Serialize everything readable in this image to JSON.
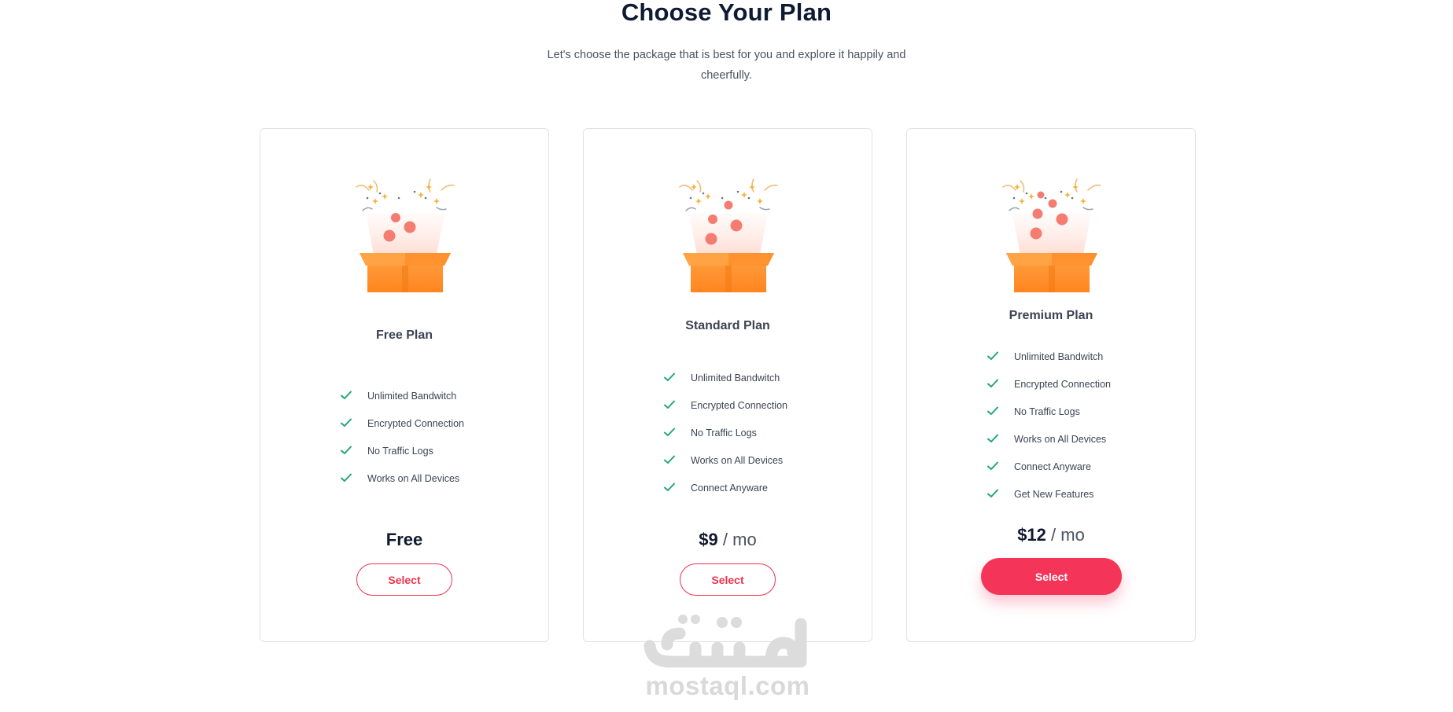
{
  "header": {
    "title": "Choose Your Plan",
    "subtitle_line1": "Let's choose the package that is best for you and explore it happily and",
    "subtitle_line2": "cheerfully."
  },
  "plans": [
    {
      "name": "Free Plan",
      "features": [
        "Unlimited Bandwitch",
        "Encrypted Connection",
        "No Traffic Logs",
        "Works on All Devices"
      ],
      "price": "Free",
      "period": "",
      "button_label": "Select"
    },
    {
      "name": "Standard Plan",
      "features": [
        "Unlimited Bandwitch",
        "Encrypted Connection",
        "No Traffic Logs",
        "Works on All Devices",
        "Connect Anyware"
      ],
      "price": "$9",
      "period": " / mo",
      "button_label": "Select"
    },
    {
      "name": "Premium Plan",
      "features": [
        "Unlimited Bandwitch",
        "Encrypted Connection",
        "No Traffic Logs",
        "Works on All Devices",
        "Connect Anyware",
        "Get New Features"
      ],
      "price": "$12",
      "period": " / mo",
      "button_label": "Select"
    }
  ],
  "watermark": {
    "text": "mostaql.com",
    "logo_text": "مستقل"
  },
  "colors": {
    "accent": "#f5345a",
    "check": "#23a47a",
    "title": "#0f1b33",
    "box_orange": "#ff8b2c"
  },
  "icons": {
    "feature": "check-icon",
    "illustration": "gift-box-icon"
  }
}
